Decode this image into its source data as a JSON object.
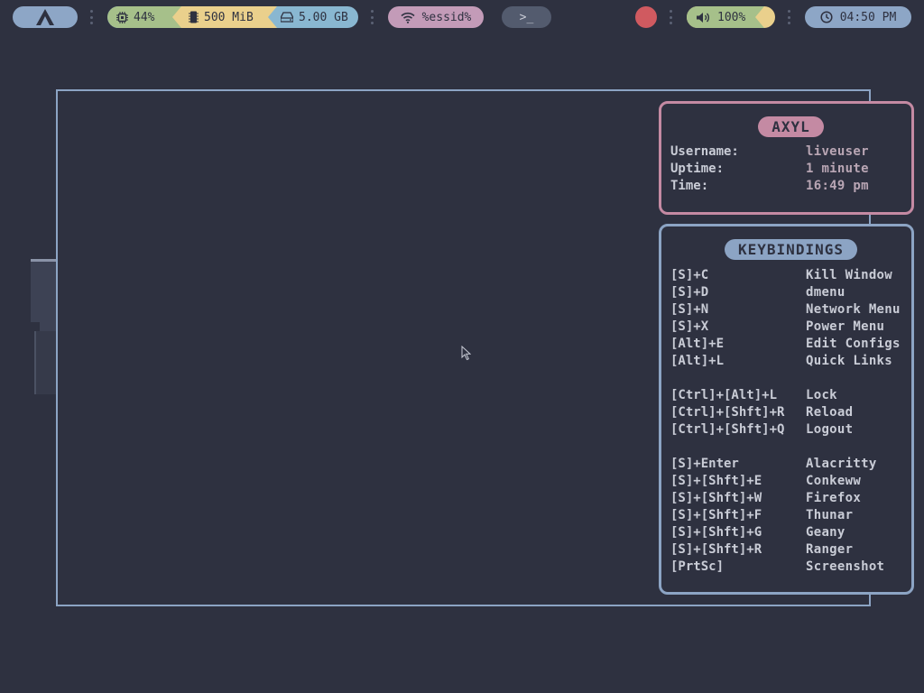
{
  "colors": {
    "background": "#2e3140",
    "frame": "#8ca4c4",
    "launcher": "#8da6c6",
    "cpu": "#a6c08a",
    "ram": "#ead08c",
    "disk": "#89b7d1",
    "network": "#c39bb8",
    "terminal": "#535b6e",
    "record": "#d05a60",
    "volume": "#a6c08a",
    "clock": "#8da6c6",
    "axyl_panel": "#c48aa3",
    "keybindings_panel": "#8ca4c4"
  },
  "topbar": {
    "launcher_icon": "arch-logo-icon",
    "cpu": {
      "icon": "cpu-icon",
      "value": "44%"
    },
    "ram": {
      "icon": "memory-icon",
      "value": "500 MiB"
    },
    "disk": {
      "icon": "disk-icon",
      "value": "5.00 GB"
    },
    "network": {
      "icon": "wifi-icon",
      "value": "%essid%"
    },
    "terminal": {
      "icon": "terminal-icon",
      "label": ">_"
    },
    "record": {
      "icon": "record-icon"
    },
    "volume": {
      "icon": "speaker-icon",
      "value": "100%"
    },
    "clock": {
      "icon": "clock-icon",
      "value": "04:50 PM"
    }
  },
  "axyl": {
    "title": "AXYL",
    "rows": [
      {
        "key": "Username:",
        "value": "liveuser"
      },
      {
        "key": "Uptime:",
        "value": "1 minute"
      },
      {
        "key": "Time:",
        "value": "16:49 pm"
      }
    ]
  },
  "keybindings": {
    "title": "KEYBINDINGS",
    "groups": [
      [
        {
          "key": "[S]+C",
          "action": "Kill Window"
        },
        {
          "key": "[S]+D",
          "action": "dmenu"
        },
        {
          "key": "[S]+N",
          "action": "Network Menu"
        },
        {
          "key": "[S]+X",
          "action": "Power Menu"
        },
        {
          "key": "[Alt]+E",
          "action": "Edit Configs"
        },
        {
          "key": "[Alt]+L",
          "action": "Quick Links"
        }
      ],
      [
        {
          "key": "[Ctrl]+[Alt]+L",
          "action": "Lock"
        },
        {
          "key": "[Ctrl]+[Shft]+R",
          "action": "Reload"
        },
        {
          "key": "[Ctrl]+[Shft]+Q",
          "action": "Logout"
        }
      ],
      [
        {
          "key": "[S]+Enter",
          "action": "Alacritty"
        },
        {
          "key": "[S]+[Shft]+E",
          "action": "Conkeww"
        },
        {
          "key": "[S]+[Shft]+W",
          "action": "Firefox"
        },
        {
          "key": "[S]+[Shft]+F",
          "action": "Thunar"
        },
        {
          "key": "[S]+[Shft]+G",
          "action": "Geany"
        },
        {
          "key": "[S]+[Shft]+R",
          "action": "Ranger"
        },
        {
          "key": "[PrtSc]",
          "action": "Screenshot"
        }
      ]
    ]
  }
}
